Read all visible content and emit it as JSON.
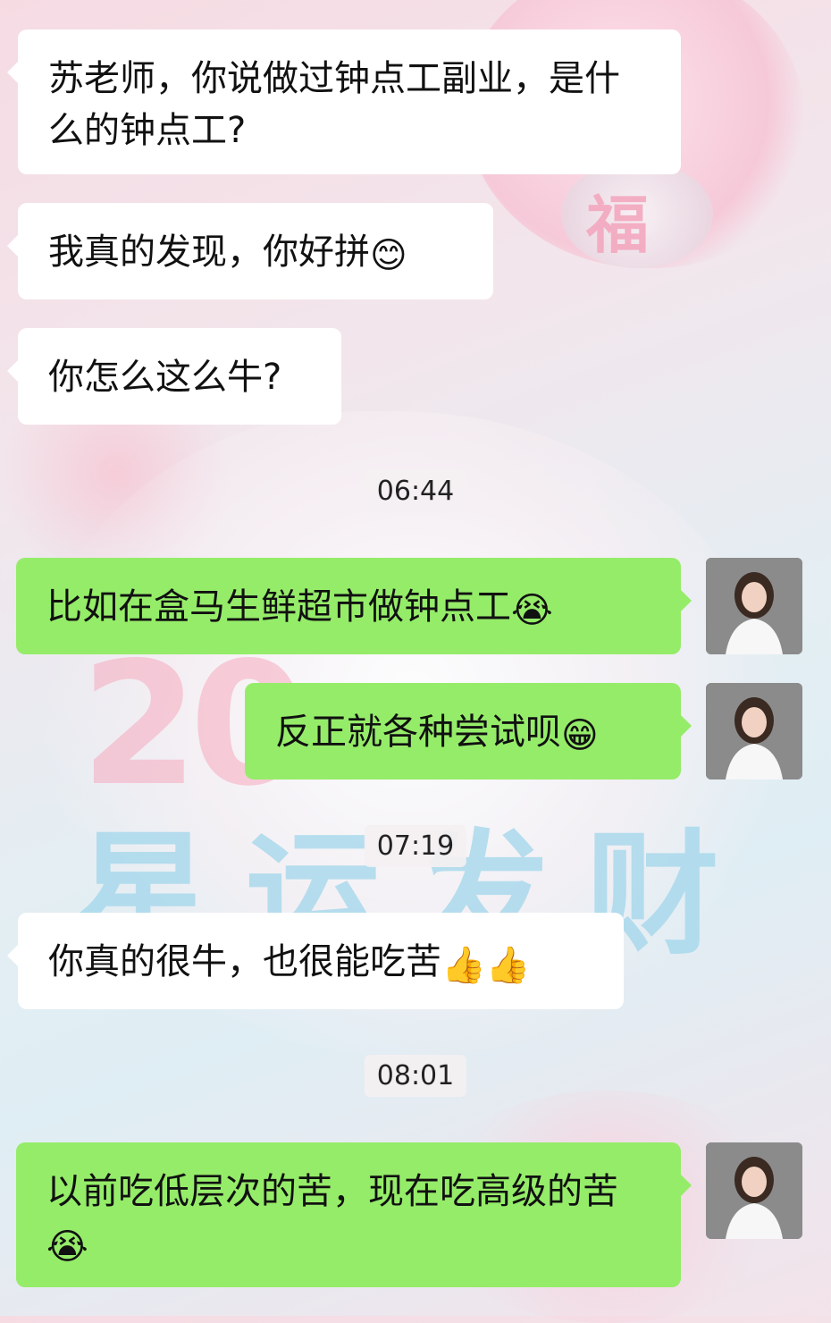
{
  "background": {
    "blessing_char": "福",
    "big_text": "星运发财",
    "year_partial": "20"
  },
  "messages": [
    {
      "side": "in",
      "text": "苏老师，你说做过钟点工副业，是什么的钟点工?",
      "emoji": ""
    },
    {
      "side": "in",
      "text": "我真的发现，你好拼",
      "emoji": "😊"
    },
    {
      "side": "in",
      "text": "你怎么这么牛?",
      "emoji": ""
    },
    {
      "side": "out",
      "text": "比如在盒马生鲜超市做钟点工",
      "emoji": "😭"
    },
    {
      "side": "out",
      "text": "反正就各种尝试呗",
      "emoji": "😁"
    },
    {
      "side": "in",
      "text": "你真的很牛，也很能吃苦",
      "emoji": "👍👍"
    },
    {
      "side": "out",
      "text": "以前吃低层次的苦，现在吃高级的苦",
      "emoji": "😭"
    }
  ],
  "timestamps": [
    "06:44",
    "07:19",
    "08:01"
  ],
  "colors": {
    "outgoing_bubble": "#95ec69",
    "incoming_bubble": "#ffffff",
    "avatar_bg": "#8b8b8b"
  }
}
